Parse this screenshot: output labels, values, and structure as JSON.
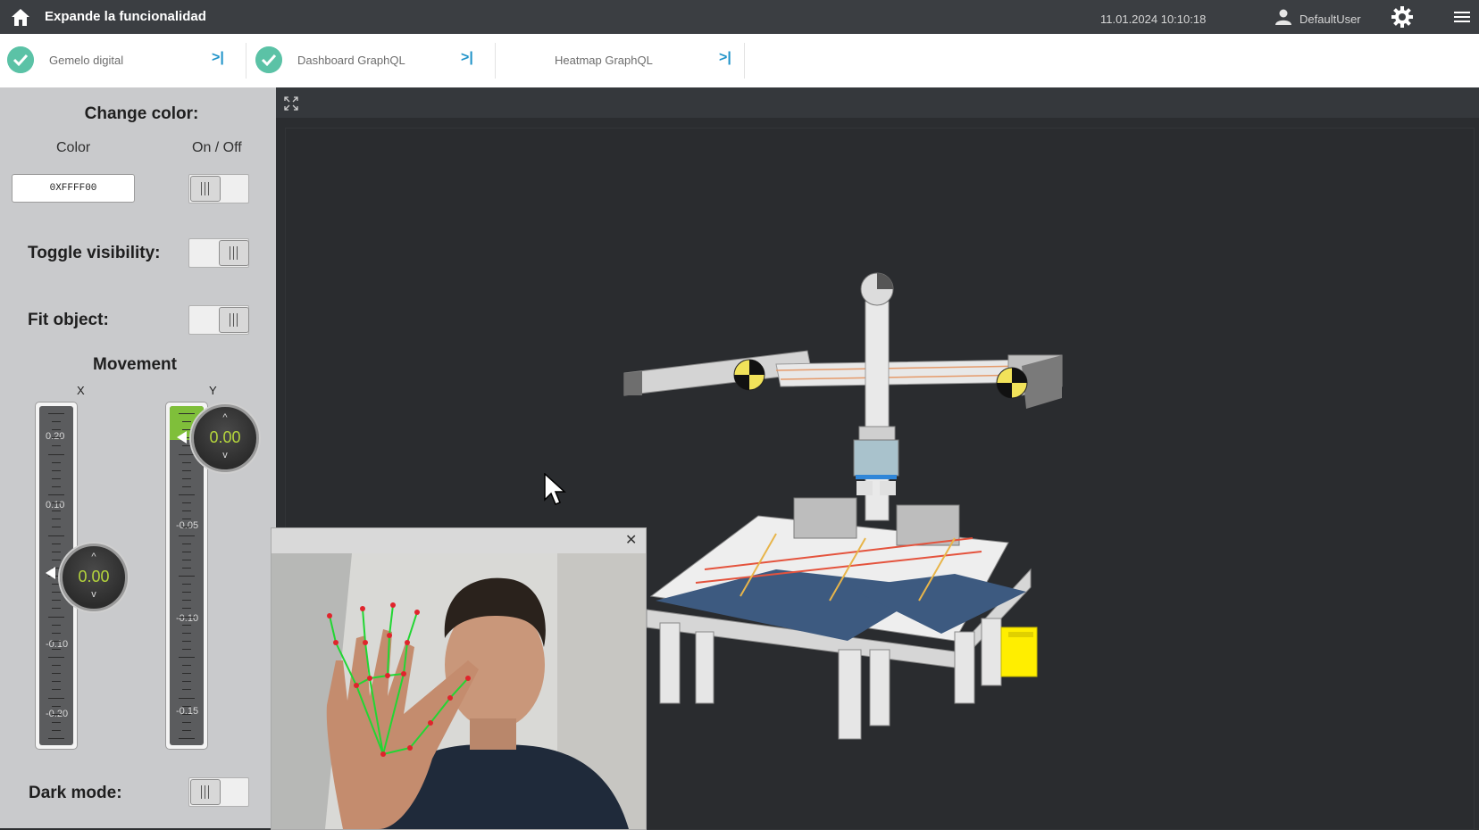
{
  "topbar": {
    "title": "Expande la funcionalidad",
    "datetime": "11.01.2024 10:10:18",
    "user": "DefaultUser"
  },
  "tabs": [
    {
      "label": "Gemelo digital",
      "checked": true
    },
    {
      "label": "Dashboard GraphQL",
      "checked": true
    },
    {
      "label": "Heatmap GraphQL",
      "checked": false
    }
  ],
  "panel": {
    "change_color": "Change color:",
    "color_col": "Color",
    "onoff_col": "On / Off",
    "color_value": "0XFFFF00",
    "toggle_visibility": "Toggle visibility:",
    "fit_object": "Fit object:",
    "movement": "Movement",
    "axis_x": "X",
    "axis_y": "Y",
    "x_value": "0.00",
    "y_value": "0.00",
    "dark_mode": "Dark mode:",
    "x_ticks": [
      "0.20",
      "0.10",
      "-0.10",
      "-0.20"
    ],
    "y_ticks": [
      "-0.05",
      "-0.10",
      "-0.15"
    ],
    "toggles": {
      "color_on": false,
      "visibility": true,
      "fit": true,
      "dark_mode": false
    }
  },
  "colors": {
    "accent": "#1f93c9",
    "check": "#5bc2a6",
    "value": "#b5d53c",
    "landmark": "#e0242c",
    "skeleton": "#22d633"
  }
}
